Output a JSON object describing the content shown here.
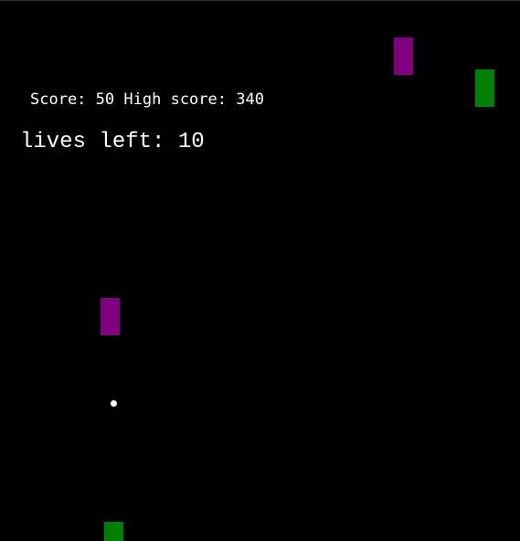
{
  "hud": {
    "score_label": "Score:",
    "score_value": "50",
    "high_score_label": "High score:",
    "high_score_value": "340",
    "lives_label": "lives left:",
    "lives_value": "10"
  },
  "colors": {
    "background": "#000000",
    "text": "#ffffff",
    "purple_block": "#800080",
    "green_block": "#008000",
    "ball": "#ffffff"
  },
  "objects": [
    {
      "name": "purple-block",
      "color": "purple_block"
    },
    {
      "name": "green-block",
      "color": "green_block"
    },
    {
      "name": "purple-block",
      "color": "purple_block"
    },
    {
      "name": "green-block",
      "color": "green_block"
    },
    {
      "name": "ball",
      "color": "ball"
    }
  ]
}
